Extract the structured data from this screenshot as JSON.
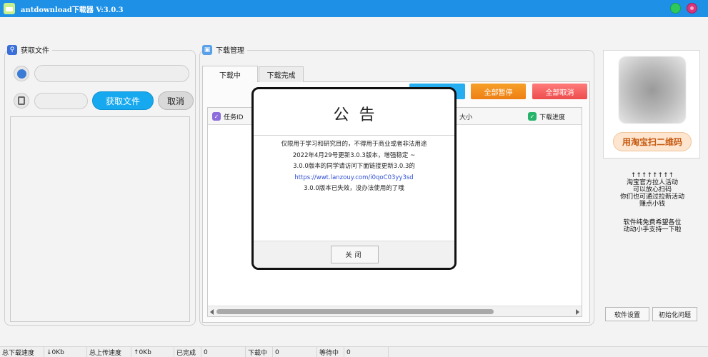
{
  "window": {
    "title": "antdownload下载器  V:3.0.3"
  },
  "fetch_group": {
    "title": "获取文件",
    "url_value": "",
    "code_value": "",
    "fetch_label": "获取文件",
    "cancel_label": "取消"
  },
  "download_group": {
    "title": "下载管理",
    "tabs": [
      "下载中",
      "下载完成"
    ],
    "actions": {
      "start_all": "",
      "pause_all": "全部暂停",
      "cancel_all": "全部取消"
    },
    "columns": {
      "task_id": "任务ID",
      "size": "大小",
      "progress": "下载进度"
    }
  },
  "promo": {
    "qr_label": "用淘宝扫二维码",
    "arrows": "↑↑↑↑↑↑↑↑",
    "lines": [
      "淘宝官方拉人活动",
      "可以放心扫码",
      "你们也可通过拉新活动",
      "赚点小钱"
    ],
    "lines2": [
      "软件纯免费希望各位",
      "动动小手支持一下啦"
    ],
    "settings_label": "软件设置",
    "init_label": "初始化问题"
  },
  "statusbar": {
    "download_speed_label": "总下载速度",
    "download_speed_value": "↓0Kb",
    "upload_speed_label": "总上传速度",
    "upload_speed_value": "↑0Kb",
    "completed_label": "已完成",
    "completed_value": "0",
    "downloading_label": "下载中",
    "downloading_value": "0",
    "waiting_label": "等待中",
    "waiting_value": "0"
  },
  "dialog": {
    "title": "公告",
    "lines": [
      "仅限用于学习和研究目的，不得用于商业或者非法用途",
      "2022年4月29号更新3.0.3版本，增强稳定 ~",
      "3.0.0版本的同学请访问下面链接更新3.0.3的",
      "https://wwt.lanzouy.com/i0qoC03yy3sd",
      "3.0.0版本已失效，没办法使用的了哦"
    ],
    "close_label": "关闭"
  },
  "colors": {
    "titlebar": "#1e90e6",
    "primary_button": "#16a9ef",
    "pause_button": "#ee7f13",
    "cancel_button": "#ee4c4c",
    "qr_label_text": "#c65a12"
  }
}
